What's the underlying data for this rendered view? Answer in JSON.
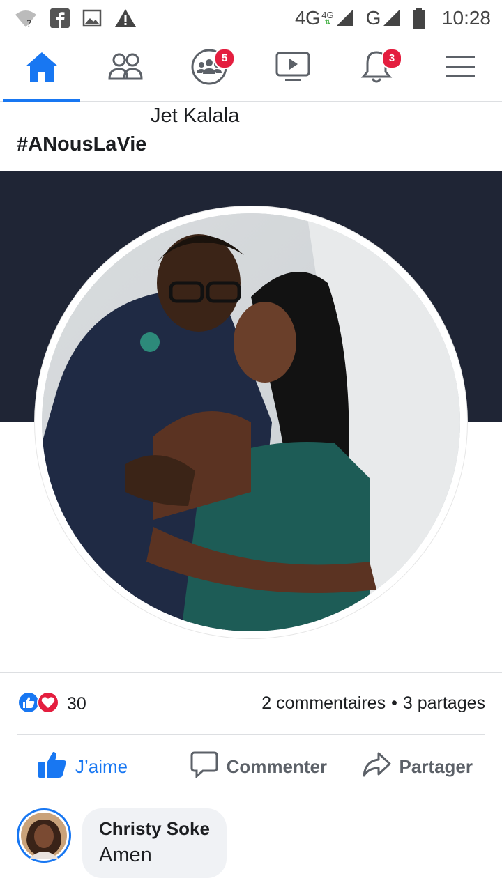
{
  "status_bar": {
    "network_label": "4G",
    "network_sub_label": "4G",
    "second_network_label": "G",
    "time": "10:28",
    "icons": [
      "wifi-question-icon",
      "facebook-icon",
      "image-icon",
      "warning-icon",
      "signal-icon",
      "battery-icon"
    ]
  },
  "nav": {
    "items": [
      {
        "name": "home",
        "icon": "home-icon",
        "active": true
      },
      {
        "name": "friends",
        "icon": "friends-icon"
      },
      {
        "name": "groups",
        "icon": "groups-icon",
        "badge": "5"
      },
      {
        "name": "watch",
        "icon": "video-icon"
      },
      {
        "name": "notifications",
        "icon": "bell-icon",
        "badge": "3"
      },
      {
        "name": "menu",
        "icon": "menu-icon"
      }
    ],
    "accent_color": "#1877f2",
    "badge_color": "#e41e3f"
  },
  "post": {
    "author": "Jet Kalala",
    "hashtag": "#ANousLaVie",
    "photo_background": "#1f2535"
  },
  "engagement": {
    "reaction_icons": [
      "like-reaction-icon",
      "love-reaction-icon"
    ],
    "reaction_count": "30",
    "comments": "2 commentaires",
    "separator": "•",
    "shares": "3 partages"
  },
  "actions": {
    "like": "J’aime",
    "comment": "Commenter",
    "share": "Partager"
  },
  "comment": {
    "author": "Christy Soke",
    "text": "Amen"
  }
}
